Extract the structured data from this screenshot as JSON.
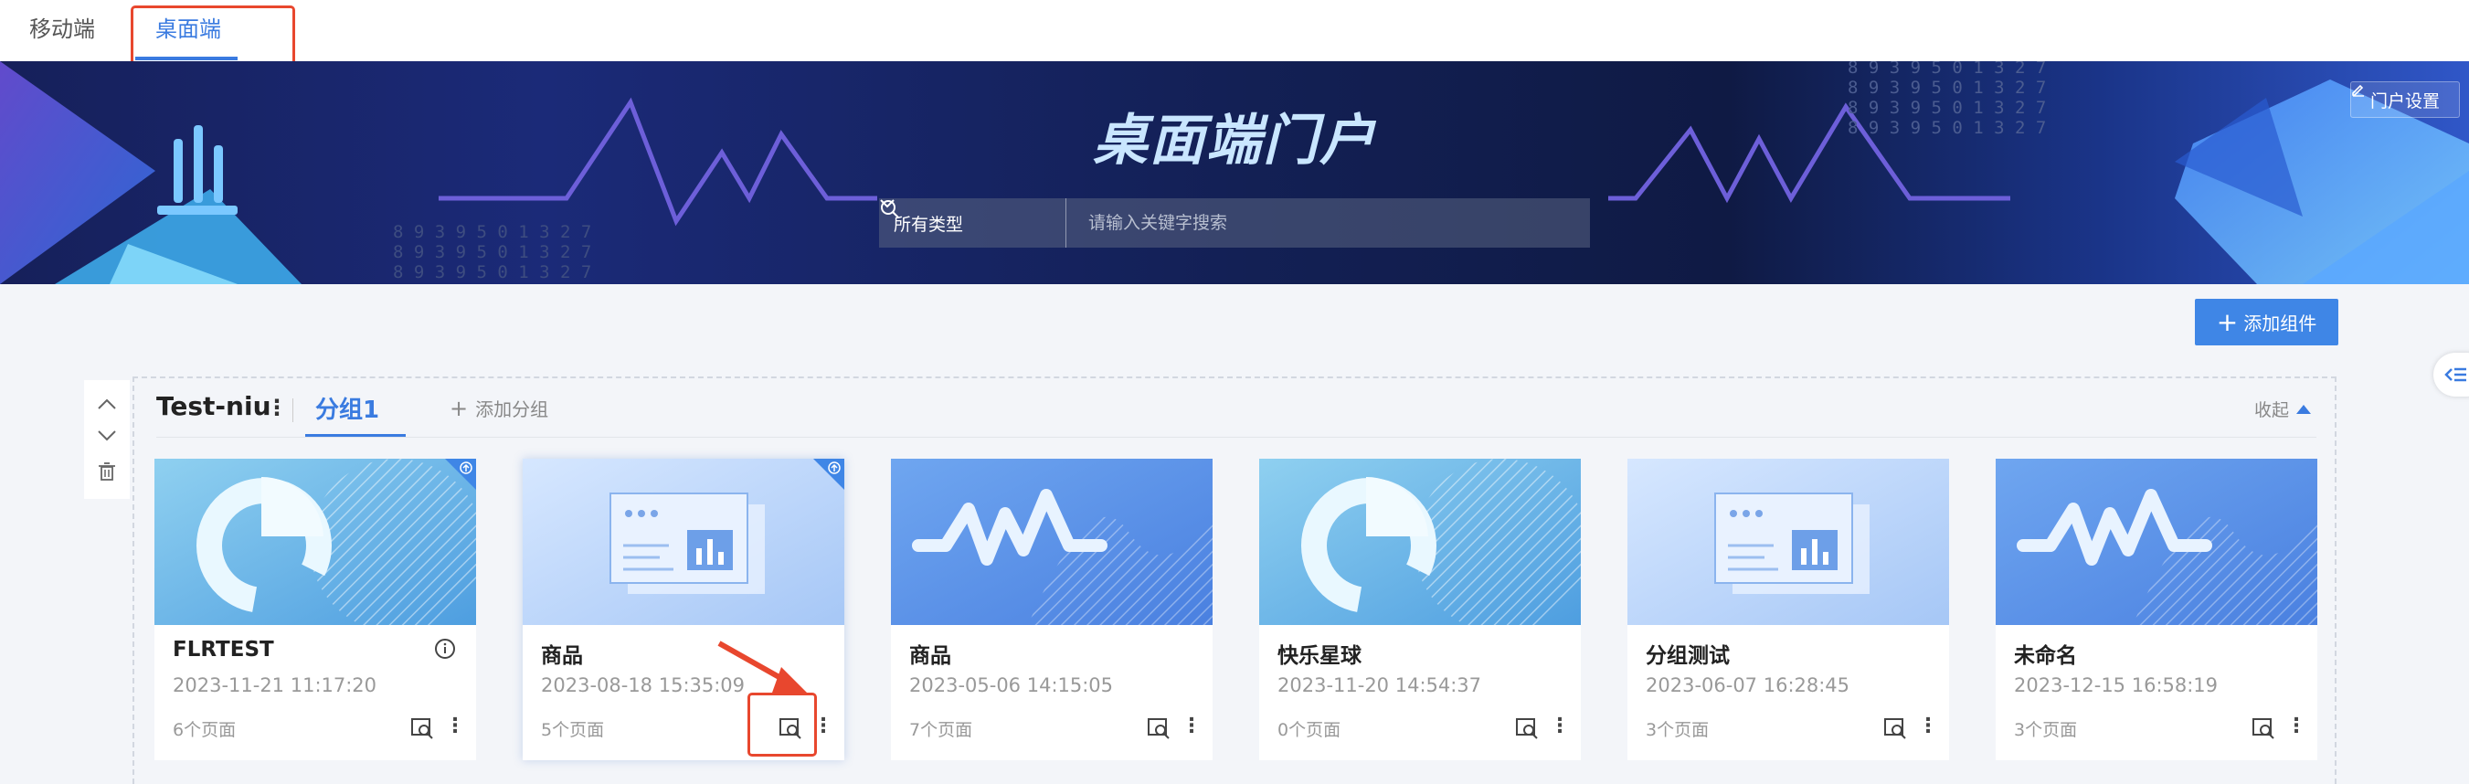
{
  "top_tabs": [
    {
      "label": "移动端",
      "active": false
    },
    {
      "label": "桌面端",
      "active": true
    }
  ],
  "banner": {
    "title": "桌面端门户",
    "portal_settings": "门户设置",
    "digits": "8 9 3 9 5 0 1 3 2 7"
  },
  "search": {
    "type_label": "所有类型",
    "placeholder": "请输入关键字搜索"
  },
  "toolbar": {
    "add_component": "添加组件"
  },
  "group": {
    "name": "Test-niu",
    "more": "⋮",
    "subtab": "分组1",
    "add_group": "添加分组",
    "collapse": "收起"
  },
  "cards": [
    {
      "title": "FLRTEST",
      "date": "2023-11-21 11:17:20",
      "pages": "6个页面",
      "thumb": "pie",
      "info_icon": true,
      "corner": true
    },
    {
      "title": "商品",
      "date": "2023-08-18 15:35:09",
      "pages": "5个页面",
      "thumb": "dashboard",
      "info_icon": false,
      "corner": true
    },
    {
      "title": "商品",
      "date": "2023-05-06 14:15:05",
      "pages": "7个页面",
      "thumb": "wave",
      "info_icon": false,
      "corner": false
    },
    {
      "title": "快乐星球",
      "date": "2023-11-20 14:54:37",
      "pages": "0个页面",
      "thumb": "pie",
      "info_icon": false,
      "corner": false
    },
    {
      "title": "分组测试",
      "date": "2023-06-07 16:28:45",
      "pages": "3个页面",
      "thumb": "dashboard",
      "info_icon": false,
      "corner": false
    },
    {
      "title": "未命名",
      "date": "2023-12-15 16:58:19",
      "pages": "3个页面",
      "thumb": "wave",
      "info_icon": false,
      "corner": false
    }
  ],
  "colors": {
    "accent": "#3a7be0",
    "highlight": "#e8472e",
    "button": "#3f86e6"
  }
}
